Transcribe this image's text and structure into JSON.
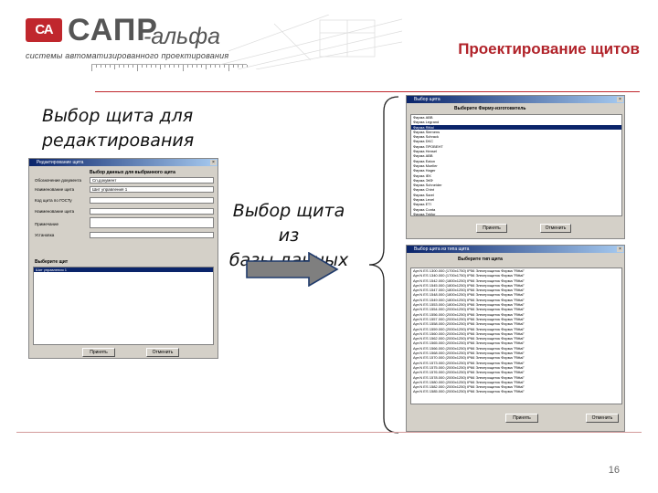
{
  "header": {
    "logo_mark": "СА",
    "logo_name": "САПР",
    "logo_suffix": "-альфа",
    "logo_tagline": "системы автоматизированного проектирования",
    "title": "Проектирование щитов"
  },
  "captions": {
    "select_edit_line1": "Выбор щита для",
    "select_edit_line2": "редактирования",
    "select_db_line1": "Выбор щита из",
    "select_db_line2": "базы данных"
  },
  "page_number": "16",
  "window_editor": {
    "title": "Редактирование щита",
    "heading": "Выбор данных для выбранного щита",
    "fields": [
      {
        "label": "Обозначение документа",
        "value": "Сп.документ"
      },
      {
        "label": "Наименование щита",
        "value": "Шит управления 1"
      },
      {
        "label": "Код щита по ГОСТу",
        "value": ""
      },
      {
        "label": "Наименование щита",
        "value": ""
      },
      {
        "label": "Примечание",
        "value": ""
      },
      {
        "label": "Установка",
        "value": ""
      }
    ],
    "list_label": "Выберите щит",
    "list_items": [
      "Шит управления 1"
    ],
    "ok_label": "Принять",
    "cancel_label": "Отменить"
  },
  "window_type": {
    "title": "Выбор щита",
    "heading": "Выберите Фирму-изготовитель",
    "items": [
      "Фирма АВВ",
      "Фирма Legrand",
      "Фирма Rittal",
      "Фирма Siemens",
      "Фирма Schrack",
      "Фирма DKC",
      "Фирма ПРОВЕНТ",
      "Фирма Hensel",
      "Фирма ABB",
      "Фирма Eaton",
      "Фирма Moeller",
      "Фирма Hager",
      "Фирма IEK",
      "Фирма ЭКФ",
      "Фирма Schneider",
      "Фирма Chint",
      "Фирма Sarel",
      "Фирма Lexel",
      "Фирма ETI",
      "Фирма Conta",
      "Фирма Tekfor",
      "Фирма СТЭК"
    ],
    "ok_label": "Принять",
    "cancel_label": "Отменить"
  },
  "window_model": {
    "title": "Выбор щита из типа щита",
    "heading": "Выберите тип щита",
    "items": [
      "Арт.N ES 1300.000 (1700x1750) IP56 Электрощиток Фирма \"Rittal\"",
      "Арт.N ES 1340.000 (1700x1750) IP56 Электрощиток Фирма \"Rittal\"",
      "Арт.N ES 1542.000 (1800x1250) IP66 Электрощиток Фирма \"Rittal\"",
      "Арт.N ES 1545.000 (1800x1250) IP66 Электрощиток Фирма \"Rittal\"",
      "Арт.N ES 1547.000 (1800x1250) IP66 Электрощиток Фирма \"Rittal\"",
      "Арт.N ES 1548.000 (1800x1250) IP66 Электрощиток Фирма \"Rittal\"",
      "Арт.N ES 1549.000 (1800x1250) IP66 Электрощиток Фирма \"Rittal\"",
      "Арт.N ES 1553.000 (1800x1250) IP66 Электрощиток Фирма \"Rittal\"",
      "Арт.N ES 1554.000 (2000x1250) IP66 Электрощиток Фирма \"Rittal\"",
      "Арт.N ES 1556.000 (2000x1250) IP66 Электрощиток Фирма \"Rittal\"",
      "Арт.N ES 1557.000 (2000x1250) IP66 Электрощиток Фирма \"Rittal\"",
      "Арт.N ES 1558.000 (2000x1250) IP66 Электрощиток Фирма \"Rittal\"",
      "Арт.N ES 1559.000 (2000x1250) IP66 Электрощиток Фирма \"Rittal\"",
      "Арт.N ES 1560.000 (2000x1250) IP66 Электрощиток Фирма \"Rittal\"",
      "Арт.N ES 1562.000 (2000x1250) IP66 Электрощиток Фирма \"Rittal\"",
      "Арт.N ES 1565.000 (2000x1250) IP66 Электрощиток Фирма \"Rittal\"",
      "Арт.N ES 1566.000 (2000x1250) IP66 Электрощиток Фирма \"Rittal\"",
      "Арт.N ES 1568.000 (2000x1250) IP66 Электрощиток Фирма \"Rittal\"",
      "Арт.N ES 1570.000 (2000x1250) IP66 Электрощиток Фирма \"Rittal\"",
      "Арт.N ES 1573.000 (2000x1250) IP66 Электрощиток Фирма \"Rittal\"",
      "Арт.N ES 1575.000 (2000x1250) IP66 Электрощиток Фирма \"Rittal\"",
      "Арт.N ES 1576.000 (2000x1250) IP66 Электрощиток Фирма \"Rittal\"",
      "Арт.N ES 1578.000 (2000x1250) IP66 Электрощиток Фирма \"Rittal\"",
      "Арт.N ES 1580.000 (2000x1250) IP66 Электрощиток Фирма \"Rittal\"",
      "Арт.N ES 1582.000 (2000x1250) IP66 Электрощиток Фирма \"Rittal\"",
      "Арт.N ES 1585.000 (2000x1250) IP66 Электрощиток Фирма \"Rittal\""
    ],
    "ok_label": "Принять",
    "cancel_label": "Отменить"
  },
  "colors": {
    "brand_red": "#c0272d",
    "title_red": "#b1232a",
    "arrow_fill": "#7f7f7f"
  }
}
